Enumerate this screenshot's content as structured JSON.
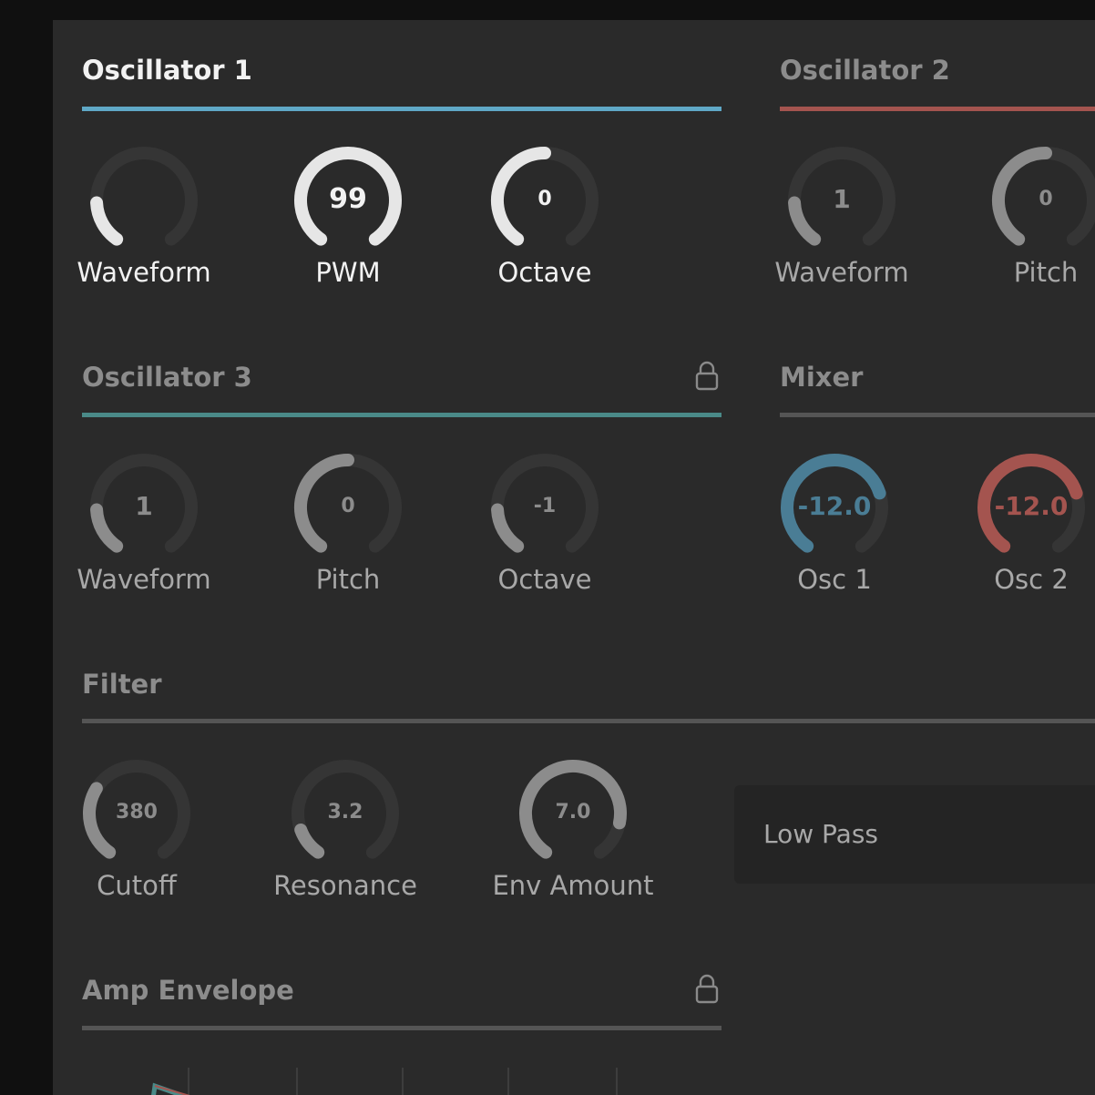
{
  "oscillator1": {
    "title": "Oscillator 1",
    "accent": "#5fa8c6",
    "knobs": [
      {
        "label": "Waveform",
        "value": "",
        "level": 0.18
      },
      {
        "label": "PWM",
        "value": "99",
        "level": 1.0
      },
      {
        "label": "Octave",
        "value": "0",
        "level": 0.5
      }
    ]
  },
  "oscillator2": {
    "title": "Oscillator 2",
    "accent": "#a4544f",
    "knobs": [
      {
        "label": "Waveform",
        "value": "1",
        "level": 0.18
      },
      {
        "label": "Pitch",
        "value": "0",
        "level": 0.5
      }
    ]
  },
  "oscillator3": {
    "title": "Oscillator 3",
    "accent": "#4a8a88",
    "lock_icon": "lock-icon",
    "knobs": [
      {
        "label": "Waveform",
        "value": "1",
        "level": 0.18
      },
      {
        "label": "Pitch",
        "value": "0",
        "level": 0.5
      },
      {
        "label": "Octave",
        "value": "-1",
        "level": 0.18
      }
    ]
  },
  "mixer": {
    "title": "Mixer",
    "accent": "#555555",
    "knobs": [
      {
        "label": "Osc 1",
        "value": "-12.0",
        "level": 0.75,
        "color": "#4a7d95"
      },
      {
        "label": "Osc 2",
        "value": "-12.0",
        "level": 0.75,
        "color": "#a4544f"
      }
    ]
  },
  "filter": {
    "title": "Filter",
    "accent": "#555555",
    "knobs": [
      {
        "label": "Cutoff",
        "value": "380",
        "level": 0.3
      },
      {
        "label": "Resonance",
        "value": "3.2",
        "level": 0.12
      },
      {
        "label": "Env Amount",
        "value": "7.0",
        "level": 0.85
      }
    ],
    "type": "Low Pass"
  },
  "amp_envelope": {
    "title": "Amp Envelope",
    "accent": "#555555",
    "lock_icon": "lock-icon"
  },
  "colors": {
    "panel": "#2a2a2a",
    "track": "#353535",
    "active_knob": "#e6e6e6",
    "inactive_knob": "#8c8c8c",
    "active_label": "#f2f2f2",
    "inactive_label": "#a8a8a8"
  }
}
